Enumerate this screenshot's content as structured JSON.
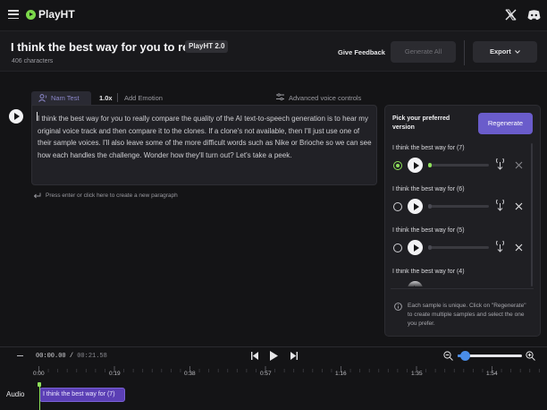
{
  "app": {
    "name": "PlayHT"
  },
  "header": {
    "title": "I think the best way for you to re...",
    "model_badge": "PlayHT 2.0",
    "char_count": "406 characters",
    "feedback_label": "Give Feedback",
    "generate_all_label": "Generate All",
    "export_label": "Export"
  },
  "editor": {
    "voice_name": "Nam Test",
    "speed": "1.0x",
    "add_emotion": "Add Emotion",
    "advanced_controls": "Advanced voice controls",
    "paragraph_text": "I think the best way for you to really compare the quality of the AI text-to-speech generation is to hear my original voice track and then compare it to the clones. If a clone's not available, then I'll just use one of their sample voices. I'll also leave some of the more difficult words such as Nike or Brioche so we can see how each handles the challenge. Wonder how they'll turn out? Let's take a peek.",
    "new_paragraph_hint": "Press enter or click here to create a new paragraph"
  },
  "versions_panel": {
    "title": "Pick your preferred version",
    "regenerate_label": "Regenerate",
    "samples": [
      {
        "label": "I think the best way for (7)",
        "selected": true
      },
      {
        "label": "I think the best way for (6)",
        "selected": false
      },
      {
        "label": "I think the best way for (5)",
        "selected": false
      },
      {
        "label": "I think the best way for (4)",
        "selected": false
      }
    ],
    "info_text": "Each sample is unique. Click on \"Regenerate\" to create multiple samples and select the one you prefer."
  },
  "timeline": {
    "current_time": "00:00.00",
    "separator": "/",
    "total_time": "00:21.58",
    "ticks": [
      "0:00",
      "0:19",
      "0:38",
      "0:57",
      "1:16",
      "1:35",
      "1:54"
    ],
    "track_label": "Audio",
    "clip_label": "I think the best way for (7)",
    "zoom_level": 0.1
  },
  "colors": {
    "accent_purple": "#6a5ccb",
    "accent_green": "#8ee05a",
    "zoom_blue": "#4a8de8"
  }
}
